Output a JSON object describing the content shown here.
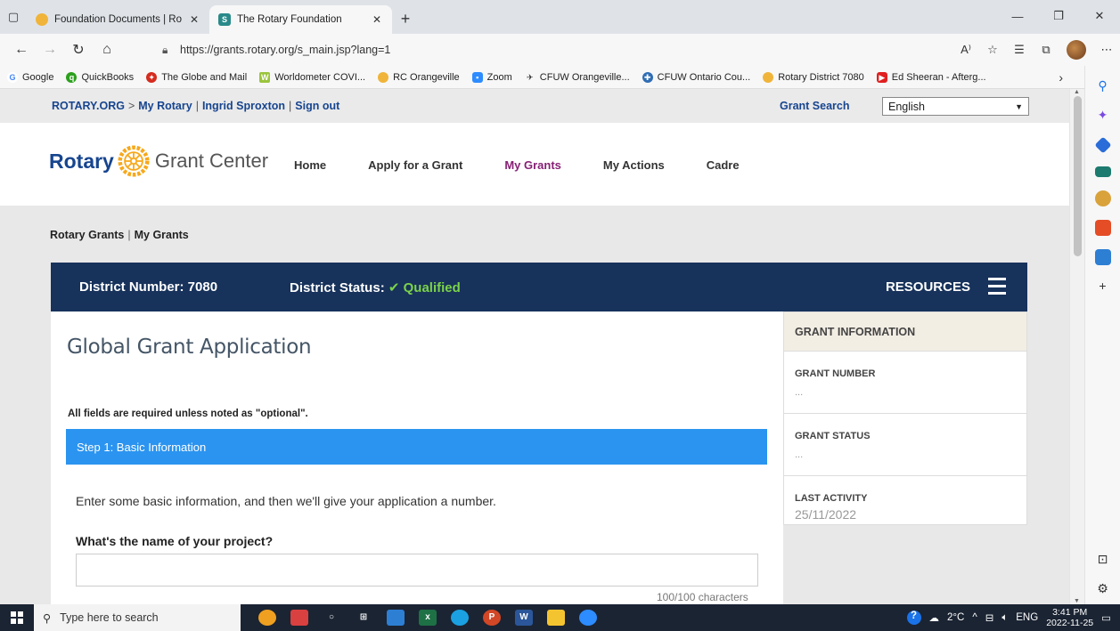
{
  "browser": {
    "tabs": [
      {
        "title": "Foundation Documents | Rotary I",
        "active": false
      },
      {
        "title": "The Rotary Foundation",
        "active": true
      }
    ],
    "url": "https://grants.rotary.org/s_main.jsp?lang=1",
    "bookmarks": [
      "Google",
      "QuickBooks",
      "The Globe and Mail",
      "Worldometer COVI...",
      "RC Orangeville",
      "Zoom",
      "CFUW Orangeville...",
      "CFUW Ontario Cou...",
      "Rotary District 7080",
      "Ed Sheeran - Afterg..."
    ]
  },
  "topnav": {
    "rotary_org": "ROTARY.ORG",
    "my_rotary": "My Rotary",
    "user": "Ingrid Sproxton",
    "sign_out": "Sign out",
    "grant_search": "Grant Search",
    "language": "English"
  },
  "header": {
    "brand": "Rotary",
    "center": "Grant Center",
    "nav": [
      "Home",
      "Apply for a Grant",
      "My Grants",
      "My Actions",
      "Cadre"
    ],
    "active_nav": "My Grants"
  },
  "breadcrumb": {
    "root": "Rotary Grants",
    "current": "My Grants"
  },
  "district": {
    "number_label": "District Number: 7080",
    "status_label": "District Status:",
    "status_value": "Qualified",
    "resources": "RESOURCES"
  },
  "form": {
    "title": "Global Grant Application",
    "required_note": "All fields are required unless noted as \"optional\".",
    "step": "Step 1: Basic Information",
    "intro": "Enter some basic information, and then we'll give your application a number.",
    "question": "What's the name of your project?",
    "char_count": "100/100 characters"
  },
  "grant_info": {
    "heading": "GRANT INFORMATION",
    "number_label": "GRANT NUMBER",
    "number_value": "...",
    "status_label": "GRANT STATUS",
    "status_value": "...",
    "activity_label": "LAST ACTIVITY",
    "activity_value": "25/11/2022"
  },
  "taskbar": {
    "search_placeholder": "Type here to search",
    "temperature": "2°C",
    "language": "ENG",
    "time": "3:41 PM",
    "date": "2022-11-25"
  },
  "colors": {
    "rotary_blue": "#17458f",
    "district_bar": "#17325b",
    "step_blue": "#2b94f0",
    "qualified": "#7bd24a",
    "active_nav": "#872175"
  }
}
